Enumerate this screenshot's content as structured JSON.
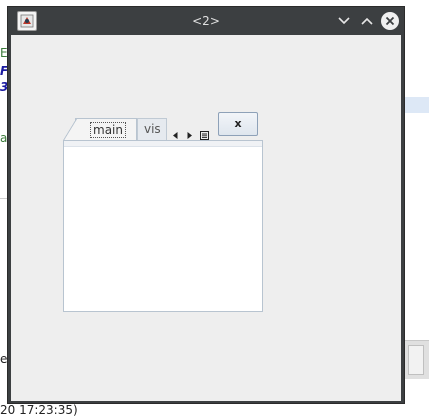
{
  "background": {
    "fragments": [
      "E",
      "F",
      "3",
      "a",
      "el",
      "20 17:23:35)"
    ]
  },
  "window": {
    "title": "<2>",
    "icons": {
      "app": "java-app-icon",
      "minimize": "chevron-down-icon",
      "maximize": "chevron-up-icon",
      "close": "close-circle-icon"
    },
    "colors": {
      "titlebar": "#3c3f41",
      "content": "#eeeeee"
    }
  },
  "tabs": {
    "items": [
      {
        "label": "main",
        "selected": true
      },
      {
        "label": "vis",
        "selected": false
      }
    ],
    "close_label": "x",
    "icons": {
      "scroll_left": "triangle-left-icon",
      "scroll_right": "triangle-right-icon",
      "list": "tab-list-icon"
    }
  }
}
